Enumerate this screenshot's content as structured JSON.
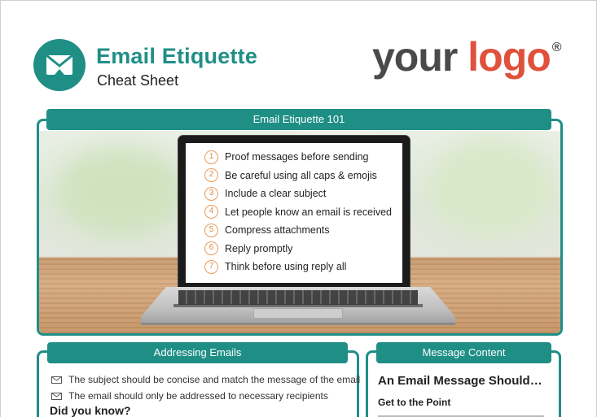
{
  "header": {
    "title": "Email Etiquette",
    "subtitle": "Cheat Sheet",
    "badge_icon": "envelope-icon",
    "logo": {
      "part1": "your",
      "part2": "logo",
      "mark": "®"
    }
  },
  "hero": {
    "heading": "Email Etiquette 101",
    "tips": [
      {
        "num": "1",
        "text": "Proof messages before sending"
      },
      {
        "num": "2",
        "text": "Be careful using all caps & emojis"
      },
      {
        "num": "3",
        "text": "Include a clear subject"
      },
      {
        "num": "4",
        "text": "Let people know an email is received"
      },
      {
        "num": "5",
        "text": "Compress attachments"
      },
      {
        "num": "6",
        "text": "Reply promptly"
      },
      {
        "num": "7",
        "text": "Think before using reply all"
      }
    ]
  },
  "addressing": {
    "heading": "Addressing Emails",
    "bullets": [
      "The subject should be concise and match the message of the email",
      "The email should only be addressed to necessary recipients"
    ],
    "did_you_know": "Did you know?",
    "bullet_icon": "envelope-icon"
  },
  "message": {
    "heading": "Message Content",
    "subheading": "An Email Message Should…",
    "point": "Get to the Point"
  },
  "colors": {
    "accent": "#1f8f86",
    "logo_red": "#e0513b",
    "logo_gray": "#4a4a4a",
    "tip_orange": "#e08a44"
  }
}
